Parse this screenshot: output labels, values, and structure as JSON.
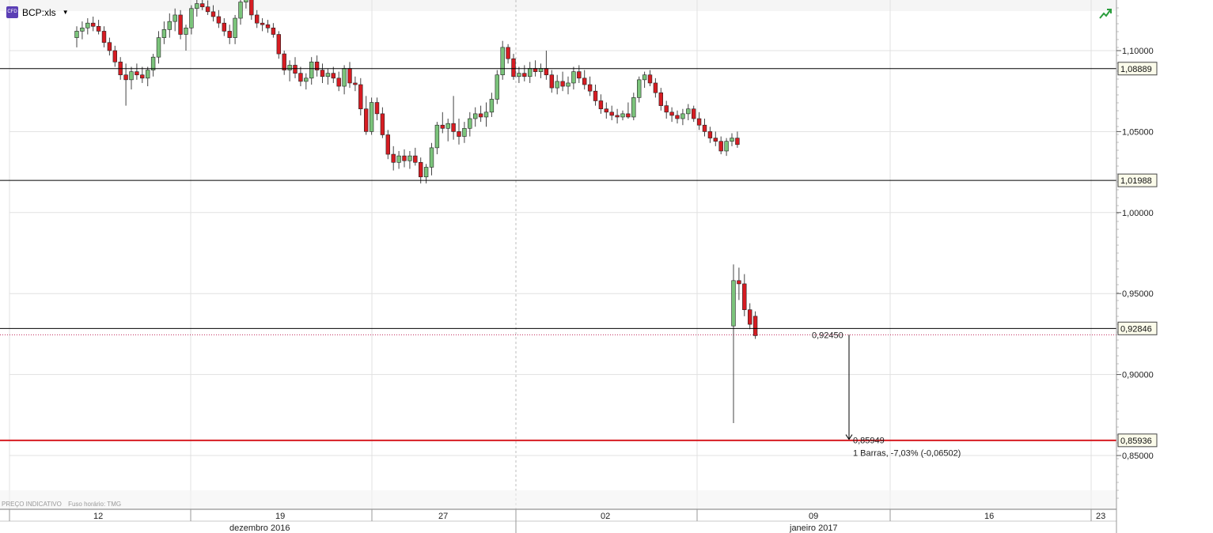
{
  "instrument": {
    "badge": "CFD",
    "label": "BCP:xls",
    "dropdown": "▼"
  },
  "footer": {
    "price_note": "PREÇO INDICATIVO",
    "timezone": "Fuso horário: TMG"
  },
  "colors": {
    "up": "#7bc47b",
    "down": "#d71c22",
    "grid": "#e1e1e1",
    "level": "#000000",
    "support": "#d71c22"
  },
  "icons": {
    "trend": "trend-up-icon"
  },
  "chart_data": {
    "type": "candlestick",
    "y_axis": {
      "ticks": [
        "1,10000",
        "1,05000",
        "1,00000",
        "0,95000",
        "0,90000",
        "0,85000"
      ],
      "tick_values": [
        1.1,
        1.05,
        1.0,
        0.95,
        0.9,
        0.85
      ],
      "range": [
        0.8,
        1.13
      ]
    },
    "x_axis": {
      "day_ticks": [
        "12",
        "19",
        "27",
        "02",
        "09",
        "16",
        "23"
      ],
      "months": [
        "dezembro 2016",
        "janeiro 2017"
      ]
    },
    "levels": [
      {
        "value": 1.08889,
        "label": "1,08889",
        "color": "#000000"
      },
      {
        "value": 1.01988,
        "label": "1,01988",
        "color": "#000000"
      },
      {
        "value": 0.92846,
        "label": "0,92846",
        "color": "#000000"
      },
      {
        "value": 0.85936,
        "label": "0,85936",
        "color": "#d71c22"
      }
    ],
    "measure": {
      "from_value": 0.9245,
      "from_label": "0,92450",
      "to_value": 0.85949,
      "to_label": "0,85949",
      "summary": "1 Barras, -7,03% (-0,06502)"
    },
    "candles": [
      [
        1.108,
        1.115,
        1.102,
        1.112
      ],
      [
        1.112,
        1.118,
        1.107,
        1.114
      ],
      [
        1.114,
        1.12,
        1.11,
        1.117
      ],
      [
        1.117,
        1.121,
        1.112,
        1.115
      ],
      [
        1.115,
        1.119,
        1.11,
        1.112
      ],
      [
        1.112,
        1.115,
        1.102,
        1.105
      ],
      [
        1.105,
        1.108,
        1.097,
        1.1
      ],
      [
        1.1,
        1.103,
        1.09,
        1.093
      ],
      [
        1.093,
        1.096,
        1.082,
        1.085
      ],
      [
        1.085,
        1.092,
        1.066,
        1.082
      ],
      [
        1.082,
        1.09,
        1.076,
        1.087
      ],
      [
        1.087,
        1.092,
        1.082,
        1.085
      ],
      [
        1.085,
        1.09,
        1.08,
        1.083
      ],
      [
        1.083,
        1.09,
        1.078,
        1.088
      ],
      [
        1.088,
        1.098,
        1.084,
        1.096
      ],
      [
        1.096,
        1.112,
        1.092,
        1.108
      ],
      [
        1.108,
        1.118,
        1.104,
        1.113
      ],
      [
        1.113,
        1.123,
        1.108,
        1.118
      ],
      [
        1.118,
        1.126,
        1.112,
        1.122
      ],
      [
        1.122,
        1.125,
        1.107,
        1.11
      ],
      [
        1.11,
        1.116,
        1.1,
        1.114
      ],
      [
        1.114,
        1.128,
        1.11,
        1.126
      ],
      [
        1.126,
        1.132,
        1.121,
        1.129
      ],
      [
        1.129,
        1.133,
        1.125,
        1.127
      ],
      [
        1.127,
        1.131,
        1.122,
        1.124
      ],
      [
        1.124,
        1.128,
        1.118,
        1.121
      ],
      [
        1.121,
        1.125,
        1.114,
        1.117
      ],
      [
        1.117,
        1.12,
        1.109,
        1.112
      ],
      [
        1.112,
        1.116,
        1.104,
        1.108
      ],
      [
        1.108,
        1.122,
        1.104,
        1.12
      ],
      [
        1.12,
        1.132,
        1.116,
        1.13
      ],
      [
        1.13,
        1.136,
        1.126,
        1.133
      ],
      [
        1.133,
        1.135,
        1.119,
        1.122
      ],
      [
        1.122,
        1.125,
        1.114,
        1.117
      ],
      [
        1.117,
        1.12,
        1.112,
        1.116
      ],
      [
        1.116,
        1.119,
        1.111,
        1.114
      ],
      [
        1.114,
        1.117,
        1.108,
        1.11
      ],
      [
        1.11,
        1.112,
        1.095,
        1.098
      ],
      [
        1.098,
        1.1,
        1.085,
        1.088
      ],
      [
        1.088,
        1.094,
        1.081,
        1.091
      ],
      [
        1.091,
        1.096,
        1.083,
        1.086
      ],
      [
        1.086,
        1.09,
        1.078,
        1.081
      ],
      [
        1.081,
        1.086,
        1.076,
        1.083
      ],
      [
        1.083,
        1.096,
        1.079,
        1.093
      ],
      [
        1.093,
        1.097,
        1.084,
        1.088
      ],
      [
        1.088,
        1.092,
        1.08,
        1.084
      ],
      [
        1.084,
        1.089,
        1.079,
        1.086
      ],
      [
        1.086,
        1.09,
        1.08,
        1.083
      ],
      [
        1.083,
        1.087,
        1.075,
        1.078
      ],
      [
        1.078,
        1.091,
        1.073,
        1.089
      ],
      [
        1.089,
        1.093,
        1.077,
        1.08
      ],
      [
        1.08,
        1.084,
        1.075,
        1.079
      ],
      [
        1.079,
        1.083,
        1.06,
        1.064
      ],
      [
        1.064,
        1.072,
        1.048,
        1.05
      ],
      [
        1.05,
        1.071,
        1.048,
        1.068
      ],
      [
        1.068,
        1.071,
        1.057,
        1.061
      ],
      [
        1.061,
        1.065,
        1.046,
        1.048
      ],
      [
        1.048,
        1.051,
        1.033,
        1.036
      ],
      [
        1.036,
        1.041,
        1.026,
        1.031
      ],
      [
        1.031,
        1.038,
        1.027,
        1.035
      ],
      [
        1.035,
        1.039,
        1.028,
        1.032
      ],
      [
        1.032,
        1.038,
        1.027,
        1.035
      ],
      [
        1.035,
        1.04,
        1.029,
        1.031
      ],
      [
        1.031,
        1.034,
        1.018,
        1.022
      ],
      [
        1.022,
        1.03,
        1.018,
        1.028
      ],
      [
        1.028,
        1.043,
        1.023,
        1.04
      ],
      [
        1.04,
        1.056,
        1.036,
        1.054
      ],
      [
        1.054,
        1.062,
        1.049,
        1.052
      ],
      [
        1.052,
        1.058,
        1.044,
        1.055
      ],
      [
        1.055,
        1.072,
        1.045,
        1.05
      ],
      [
        1.05,
        1.058,
        1.042,
        1.047
      ],
      [
        1.047,
        1.056,
        1.043,
        1.052
      ],
      [
        1.052,
        1.062,
        1.047,
        1.058
      ],
      [
        1.058,
        1.065,
        1.053,
        1.061
      ],
      [
        1.061,
        1.066,
        1.056,
        1.059
      ],
      [
        1.059,
        1.068,
        1.053,
        1.062
      ],
      [
        1.062,
        1.074,
        1.059,
        1.07
      ],
      [
        1.07,
        1.088,
        1.067,
        1.085
      ],
      [
        1.085,
        1.106,
        1.082,
        1.102
      ],
      [
        1.102,
        1.104,
        1.092,
        1.095
      ],
      [
        1.095,
        1.098,
        1.082,
        1.084
      ],
      [
        1.084,
        1.09,
        1.08,
        1.086
      ],
      [
        1.086,
        1.091,
        1.081,
        1.084
      ],
      [
        1.084,
        1.093,
        1.08,
        1.089
      ],
      [
        1.089,
        1.094,
        1.084,
        1.087
      ],
      [
        1.087,
        1.092,
        1.083,
        1.089
      ],
      [
        1.089,
        1.1,
        1.082,
        1.085
      ],
      [
        1.085,
        1.088,
        1.074,
        1.077
      ],
      [
        1.077,
        1.085,
        1.073,
        1.081
      ],
      [
        1.081,
        1.087,
        1.075,
        1.078
      ],
      [
        1.078,
        1.084,
        1.073,
        1.08
      ],
      [
        1.08,
        1.09,
        1.076,
        1.087
      ],
      [
        1.087,
        1.091,
        1.08,
        1.083
      ],
      [
        1.083,
        1.088,
        1.076,
        1.079
      ],
      [
        1.079,
        1.084,
        1.072,
        1.075
      ],
      [
        1.075,
        1.079,
        1.066,
        1.069
      ],
      [
        1.069,
        1.073,
        1.061,
        1.064
      ],
      [
        1.064,
        1.068,
        1.058,
        1.062
      ],
      [
        1.062,
        1.066,
        1.057,
        1.06
      ],
      [
        1.06,
        1.064,
        1.055,
        1.059
      ],
      [
        1.059,
        1.063,
        1.057,
        1.061
      ],
      [
        1.061,
        1.068,
        1.058,
        1.059
      ],
      [
        1.059,
        1.074,
        1.057,
        1.071
      ],
      [
        1.071,
        1.084,
        1.068,
        1.082
      ],
      [
        1.082,
        1.087,
        1.077,
        1.085
      ],
      [
        1.085,
        1.088,
        1.078,
        1.08
      ],
      [
        1.08,
        1.083,
        1.071,
        1.074
      ],
      [
        1.074,
        1.077,
        1.063,
        1.066
      ],
      [
        1.066,
        1.069,
        1.058,
        1.062
      ],
      [
        1.062,
        1.065,
        1.056,
        1.06
      ],
      [
        1.06,
        1.063,
        1.055,
        1.058
      ],
      [
        1.058,
        1.064,
        1.054,
        1.061
      ],
      [
        1.061,
        1.067,
        1.057,
        1.064
      ],
      [
        1.064,
        1.066,
        1.056,
        1.058
      ],
      [
        1.058,
        1.062,
        1.051,
        1.054
      ],
      [
        1.054,
        1.058,
        1.047,
        1.05
      ],
      [
        1.05,
        1.053,
        1.043,
        1.046
      ],
      [
        1.046,
        1.05,
        1.041,
        1.044
      ],
      [
        1.044,
        1.047,
        1.036,
        1.038
      ],
      [
        1.038,
        1.046,
        1.035,
        1.044
      ],
      [
        1.044,
        1.049,
        1.041,
        1.046
      ],
      [
        1.046,
        1.05,
        1.04,
        1.042
      ]
    ],
    "extra_candles": [
      [
        0.93,
        0.968,
        0.87,
        0.958
      ],
      [
        0.958,
        0.966,
        0.946,
        0.956
      ],
      [
        0.956,
        0.962,
        0.936,
        0.94
      ],
      [
        0.94,
        0.944,
        0.928,
        0.931
      ],
      [
        0.936,
        0.939,
        0.922,
        0.924
      ]
    ]
  }
}
